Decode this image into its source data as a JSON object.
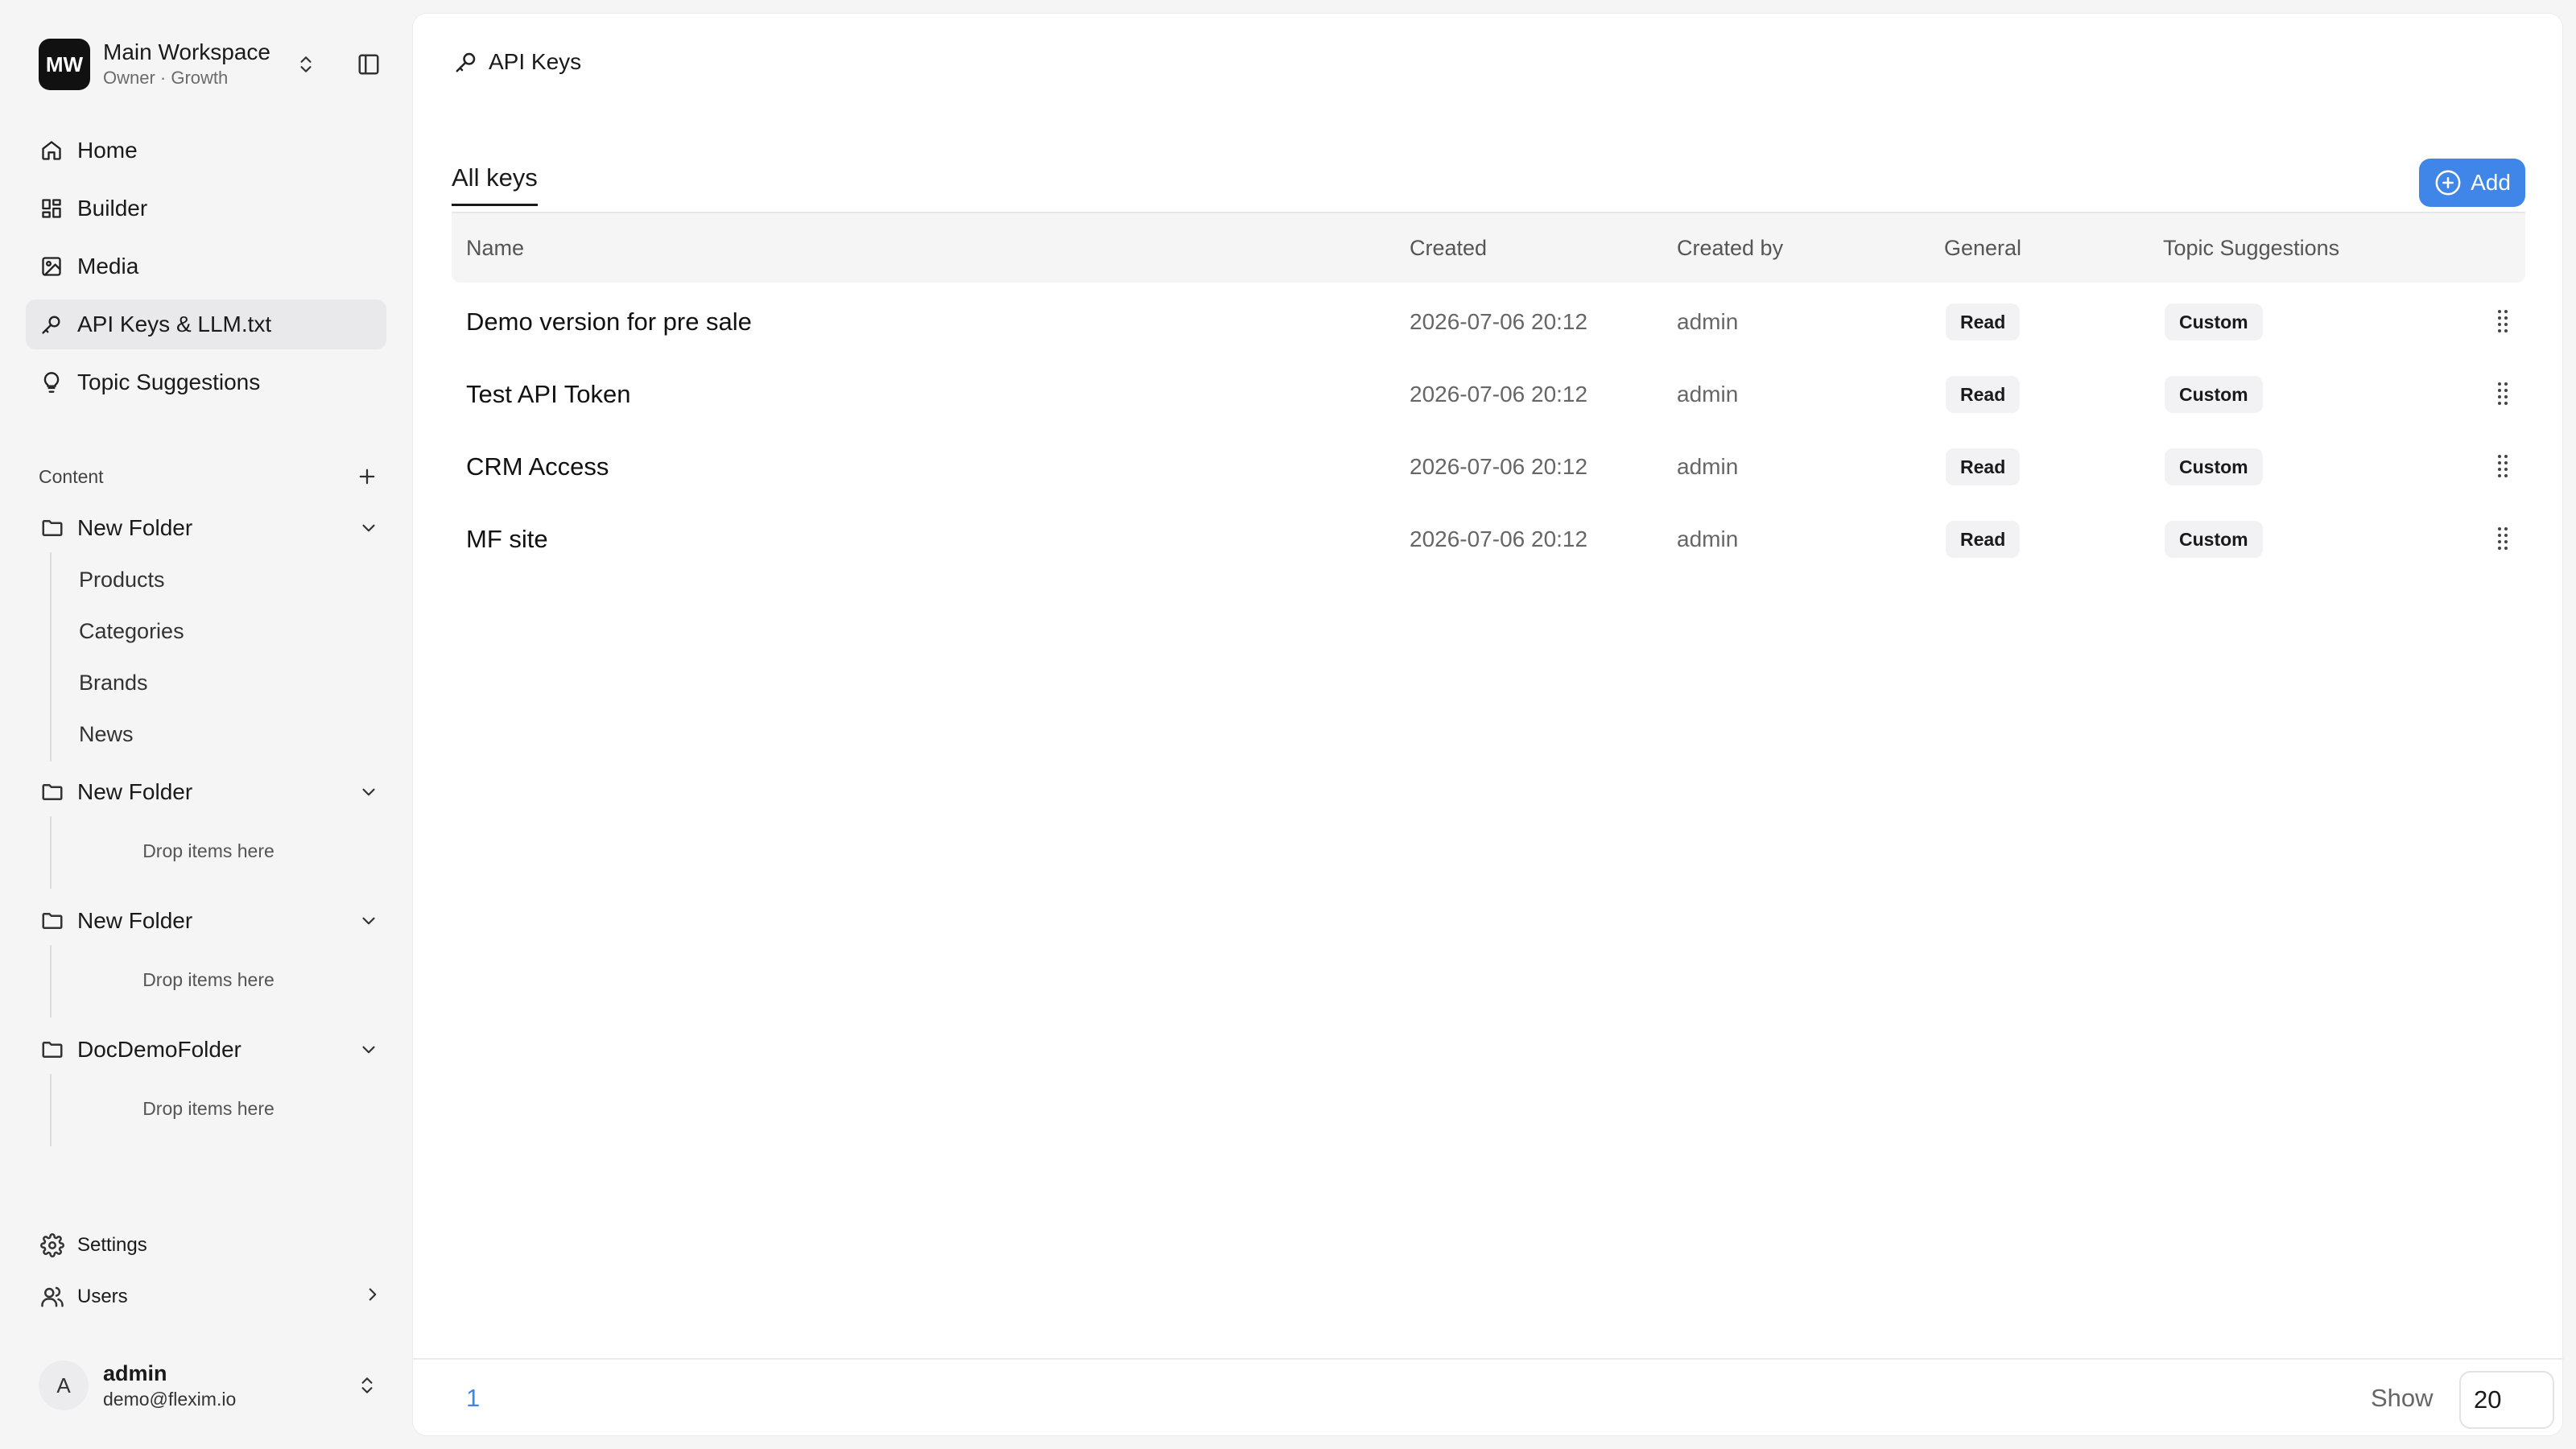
{
  "workspace": {
    "avatar_initials": "MW",
    "name": "Main Workspace",
    "subtitle": "Owner · Growth"
  },
  "nav": [
    {
      "label": "Home",
      "icon": "home-icon",
      "active": false
    },
    {
      "label": "Builder",
      "icon": "grid-icon",
      "active": false
    },
    {
      "label": "Media",
      "icon": "image-icon",
      "active": false
    },
    {
      "label": "API Keys & LLM.txt",
      "icon": "key-icon",
      "active": true
    },
    {
      "label": "Topic Suggestions",
      "icon": "lightbulb-icon",
      "active": false
    }
  ],
  "content": {
    "label": "Content",
    "folders": [
      {
        "name": "New Folder",
        "items": [
          "Products",
          "Categories",
          "Brands",
          "News"
        ]
      },
      {
        "name": "New Folder",
        "drop_text": "Drop items here"
      },
      {
        "name": "New Folder",
        "drop_text": "Drop items here"
      },
      {
        "name": "DocDemoFolder",
        "drop_text": "Drop items here"
      }
    ]
  },
  "bottom_nav": {
    "settings": "Settings",
    "users": "Users"
  },
  "user": {
    "avatar_initial": "A",
    "name": "admin",
    "email": "demo@flexim.io"
  },
  "page": {
    "title": "API Keys",
    "tab": "All keys",
    "add_label": "Add"
  },
  "table": {
    "headers": [
      "Name",
      "Created",
      "Created by",
      "General",
      "Topic Suggestions"
    ],
    "rows": [
      {
        "name": "Demo version for pre sale",
        "created": "2026-07-06 20:12",
        "created_by": "admin",
        "general": "Read",
        "topic": "Custom"
      },
      {
        "name": "Test API Token",
        "created": "2026-07-06 20:12",
        "created_by": "admin",
        "general": "Read",
        "topic": "Custom"
      },
      {
        "name": "CRM Access",
        "created": "2026-07-06 20:12",
        "created_by": "admin",
        "general": "Read",
        "topic": "Custom"
      },
      {
        "name": "MF site",
        "created": "2026-07-06 20:12",
        "created_by": "admin",
        "general": "Read",
        "topic": "Custom"
      }
    ]
  },
  "pagination": {
    "current_page": "1",
    "show_label": "Show",
    "page_size": "20"
  },
  "colors": {
    "accent": "#3f86e8",
    "sidebar_bg": "#f5f5f6",
    "active_bg": "#e9e9ec"
  }
}
